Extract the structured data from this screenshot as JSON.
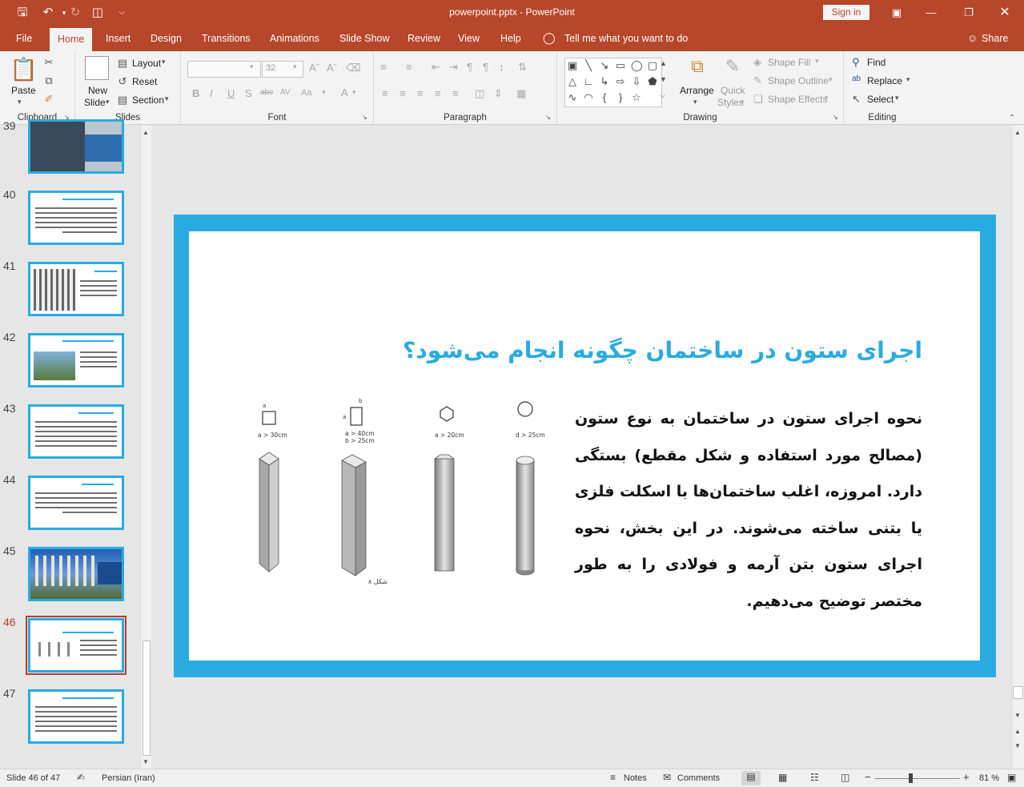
{
  "window": {
    "title": "powerpoint.pptx  -  PowerPoint",
    "signin": "Sign in"
  },
  "tabs": [
    "File",
    "Home",
    "Insert",
    "Design",
    "Transitions",
    "Animations",
    "Slide Show",
    "Review",
    "View",
    "Help"
  ],
  "tell_me": "Tell me what you want to do",
  "share": "Share",
  "ribbon": {
    "clipboard": {
      "label": "Clipboard",
      "paste": "Paste"
    },
    "slides": {
      "label": "Slides",
      "new_slide_1": "New",
      "new_slide_2": "Slide",
      "layout": "Layout",
      "reset": "Reset",
      "section": "Section"
    },
    "font": {
      "label": "Font",
      "size": "32"
    },
    "paragraph": {
      "label": "Paragraph"
    },
    "drawing": {
      "label": "Drawing",
      "arrange": "Arrange",
      "quick_styles_1": "Quick",
      "quick_styles_2": "Styles",
      "shape_fill": "Shape Fill",
      "shape_outline": "Shape Outline",
      "shape_effects": "Shape Effects"
    },
    "editing": {
      "label": "Editing",
      "find": "Find",
      "replace": "Replace",
      "select": "Select"
    }
  },
  "thumbnails": [
    {
      "num": "39",
      "title": ""
    },
    {
      "num": "40",
      "title": "مشکل ایجاد ستون بتنی در ساختمان چه کسانی مجاز است؟"
    },
    {
      "num": "41",
      "title": "ستون در ساختمان"
    },
    {
      "num": "42",
      "title": "مشکلات برای ستون ها"
    },
    {
      "num": "43",
      "title": "ستون"
    },
    {
      "num": "44",
      "title": "ستون"
    },
    {
      "num": "45",
      "title": ""
    },
    {
      "num": "46",
      "title": "اجرای ستون در ساختمان چگونه انجام می‌شود؟",
      "active": true
    },
    {
      "num": "47",
      "title": "اجرای ستون فولادی در ساختمان"
    }
  ],
  "slide": {
    "title": "اجرای ستون در ساختمان چگونه انجام می‌شود؟",
    "body": "نحوه اجرای ستون در ساختمان به نوع ستون (مصالح مورد استفاده و شکل مقطع) بستگی دارد. امروزه، اغلب ساختمان‌ها با اسکلت فلزی یا بتنی ساخته می‌شوند. در این بخش، نحوه اجرای ستون بتن آرمه و فولادی را به طور مختصر توضیح می‌دهیم.",
    "figure": {
      "labels": [
        "a > 30cm",
        "a > 40cm",
        "b > 25cm",
        "a > 20cm",
        "d > 25cm"
      ],
      "caption": "شکل ۸"
    }
  },
  "status": {
    "slide": "Slide 46 of 47",
    "language": "Persian (Iran)",
    "notes": "Notes",
    "comments": "Comments",
    "zoom": "81 %"
  },
  "colors": {
    "accent": "#b7472a",
    "slide_border": "#29abe2"
  }
}
